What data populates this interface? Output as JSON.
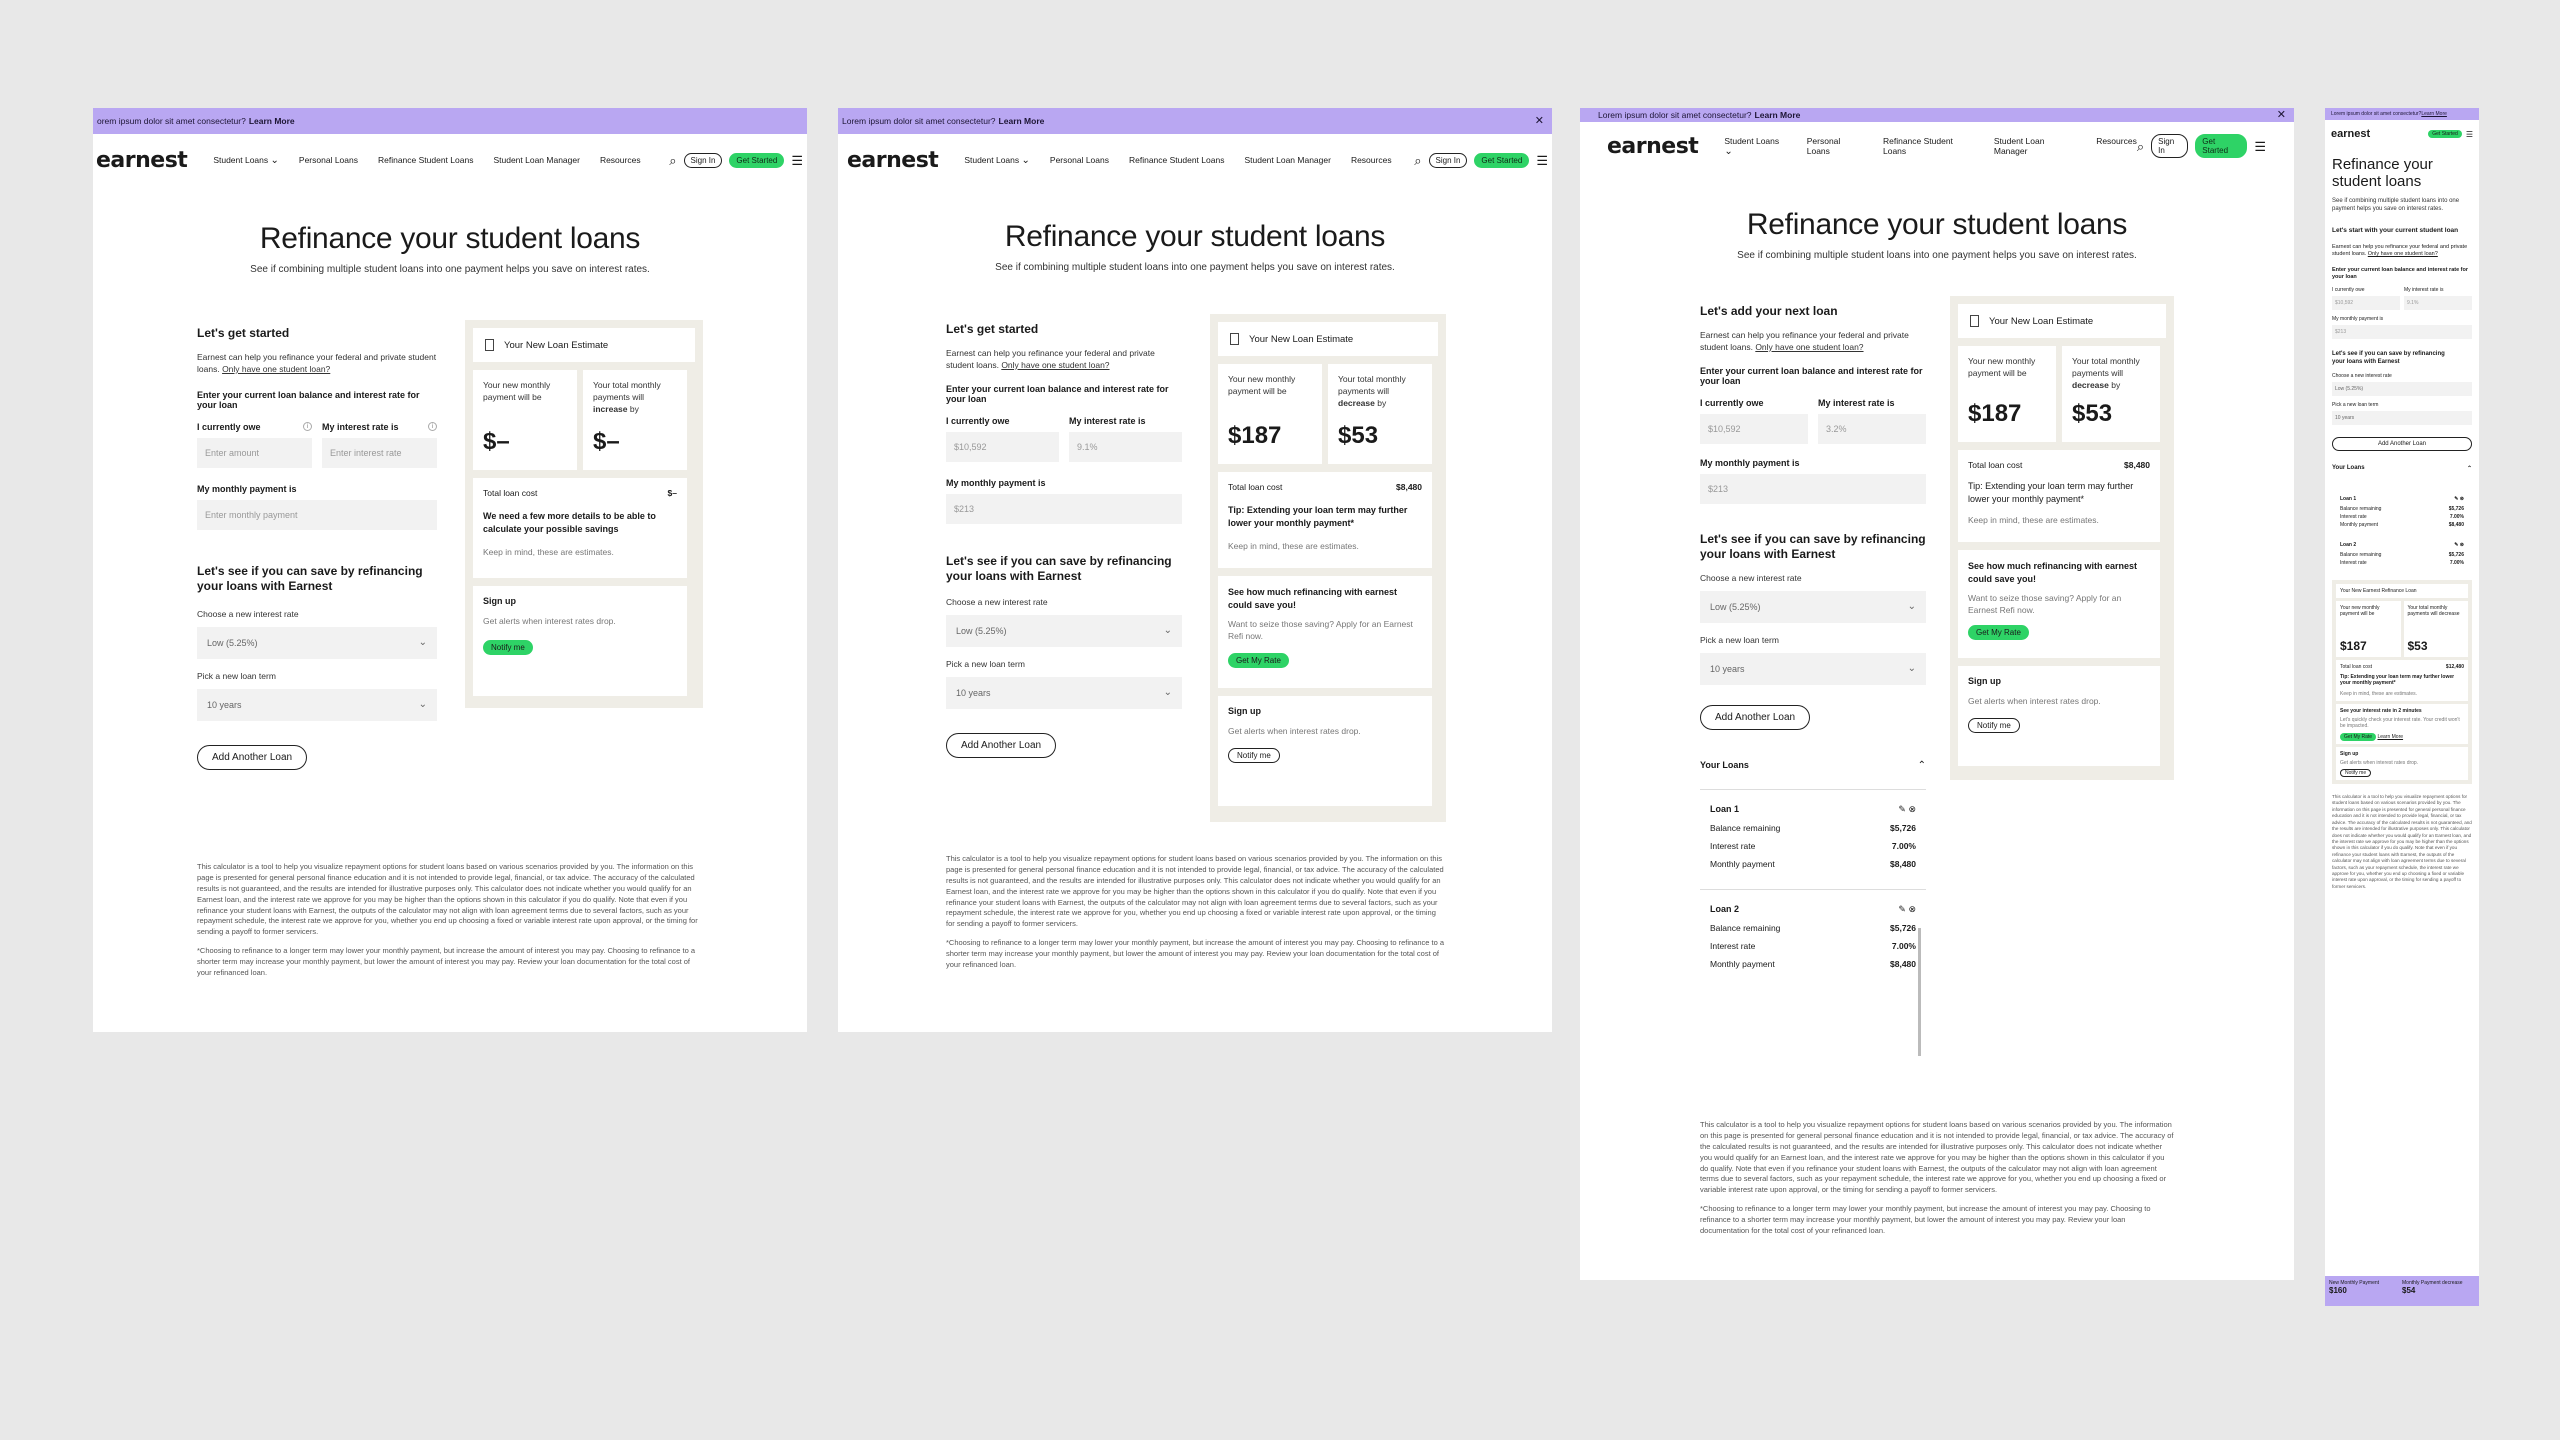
{
  "banner": {
    "text": "Lorem ipsum dolor sit amet consectetur?",
    "link": "Learn More",
    "text_f1": "orem ipsum dolor sit amet consectetur?"
  },
  "nav": {
    "logo": "earnest",
    "links": [
      "Student Loans",
      "Personal Loans",
      "Refinance Student Loans",
      "Student Loan Manager",
      "Resources"
    ],
    "sign_in": "Sign In",
    "get_started": "Get Started"
  },
  "hero": {
    "title": "Refinance your student loans",
    "subtitle": "See if combining multiple student loans into one payment helps you save on interest rates.",
    "title_mobile": "Refinance your student loans",
    "subtitle_mobile": "See if combining multiple student loans into one payment helps you save on interest rates."
  },
  "form": {
    "heading_start": "Let's get started",
    "heading_next": "Let's add your next loan",
    "heading_mobile_start": "Let's start with your current student loan",
    "intro": "Earnest can help you refinance your federal and private student loans.",
    "intro_link": "Only have one student loan?",
    "balance_prompt": "Enter your current loan balance and interest rate for your loan",
    "owe_label": "I currently owe",
    "rate_label": "My interest rate is",
    "owe_placeholder": "Enter amount",
    "rate_placeholder": "Enter interest rate",
    "monthly_label": "My monthly payment is",
    "monthly_placeholder": "Enter monthly payment",
    "owe_value": "$10,592",
    "rate_value": "9.1%",
    "rate_value_f3": "3.2%",
    "monthly_value": "$213",
    "save_heading": "Let's see if you can save by refinancing your loans with Earnest",
    "new_rate_label": "Choose a new interest rate",
    "new_rate_value": "Low (5.25%)",
    "term_label": "Pick a new loan term",
    "term_value": "10 years",
    "add_loan": "Add Another Loan"
  },
  "estimate": {
    "title": "Your New Loan Estimate",
    "title_mobile": "Your New Earnest Refinance Loan",
    "monthly_label": "Your new monthly payment will be",
    "total_label_a": "Your total monthly payments will",
    "increase": "increase",
    "decrease": "decrease",
    "by": "by",
    "empty_value": "$–",
    "monthly_value": "$187",
    "total_value": "$53",
    "total_cost_label": "Total loan cost",
    "total_cost_empty": "$–",
    "total_cost_value": "$8,480",
    "total_cost_mobile": "$12,480",
    "need_details": "We need a few more details to be able to calculate your possible savings",
    "tip": "Tip: Extending your loan term may further lower your monthly payment*",
    "keep_in_mind": "Keep in mind, these are estimates.",
    "see_how": "See how much refinancing with earnest could save you!",
    "seize": "Want to seize those saving? Apply for an Earnest Refi now.",
    "get_rate": "Get My Rate",
    "mobile_rate_heading": "See your interest rate in 2 minutes",
    "mobile_rate_text": "Let's quickly check your interest rate. Your credit won't be impacted.",
    "learn_more": "Learn More",
    "signup_title": "Sign up",
    "signup_text": "Get alerts when interest rates drop.",
    "notify_btn": "Notify me"
  },
  "loans": {
    "heading": "Your Loans",
    "items": [
      {
        "name": "Loan 1",
        "balance_label": "Balance remaining",
        "balance": "$5,726",
        "rate_label": "Interest rate",
        "rate": "7.00%",
        "monthly_label": "Monthly payment",
        "monthly": "$8,480"
      },
      {
        "name": "Loan 2",
        "balance_label": "Balance remaining",
        "balance": "$5,726",
        "rate_label": "Interest rate",
        "rate": "7.00%",
        "monthly_label": "Monthly payment",
        "monthly": "$8,480"
      }
    ]
  },
  "disclaimer": {
    "p1": "This calculator is a tool to help you visualize repayment options for student loans based on various scenarios provided by you. The information on this page is presented for general personal finance education and it is not intended to provide legal, financial, or tax advice. The accuracy of the calculated results is not guaranteed, and the results are intended for illustrative purposes only. This calculator does not indicate whether you would qualify for an Earnest loan, and the interest rate we approve for you may be higher than the options shown in this calculator if you do qualify. Note that even if you refinance your student loans with Earnest, the outputs of the calculator may not align with loan agreement terms due to several factors, such as your repayment schedule, the interest rate we approve for you, whether you end up choosing a fixed or variable interest rate upon approval, or the timing for sending a payoff to former servicers.",
    "p2": "*Choosing to refinance to a longer term may lower your monthly payment, but increase the amount of interest you may pay. Choosing to refinance to a shorter term may increase your monthly payment, but lower the amount of interest you may pay. Review your loan documentation for the total cost of your refinanced loan."
  },
  "mobile_footer": {
    "left_label": "New Monthly Payment",
    "left_value": "$160",
    "right_label": "Monthly Payment decrease",
    "right_value": "$54"
  }
}
